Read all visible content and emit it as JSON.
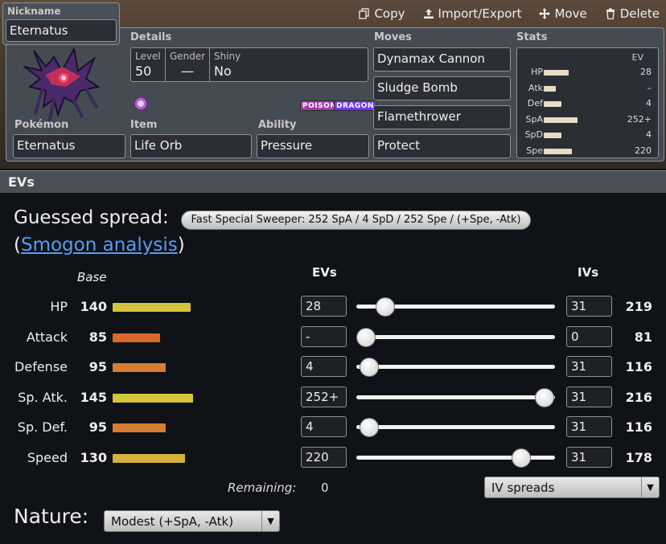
{
  "toolbar": {
    "copy": "Copy",
    "import_export": "Import/Export",
    "move": "Move",
    "delete": "Delete"
  },
  "nickname": {
    "label": "Nickname",
    "value": "Eternatus"
  },
  "details": {
    "label": "Details",
    "level_label": "Level",
    "level": "50",
    "gender_label": "Gender",
    "gender": "—",
    "shiny_label": "Shiny",
    "shiny": "No"
  },
  "pokemon": {
    "label": "Pokémon",
    "value": "Eternatus"
  },
  "item": {
    "label": "Item",
    "value": "Life Orb"
  },
  "ability": {
    "label": "Ability",
    "value": "Pressure"
  },
  "types": [
    {
      "name": "POISON",
      "color": "#a040a0"
    },
    {
      "name": "DRAGON",
      "color": "#7038f8"
    }
  ],
  "moves": {
    "label": "Moves",
    "list": [
      "Dynamax Cannon",
      "Sludge Bomb",
      "Flamethrower",
      "Protect"
    ]
  },
  "stats": {
    "label": "Stats",
    "ev_header": "EV",
    "rows": [
      {
        "name": "HP",
        "ev": "28",
        "bar": 0.45
      },
      {
        "name": "Atk",
        "ev": "–",
        "bar": 0.22
      },
      {
        "name": "Def",
        "ev": "4",
        "bar": 0.33
      },
      {
        "name": "SpA",
        "ev": "252+",
        "bar": 0.62
      },
      {
        "name": "SpD",
        "ev": "4",
        "bar": 0.33
      },
      {
        "name": "Spe",
        "ev": "220",
        "bar": 0.52
      }
    ]
  },
  "ev_panel": {
    "title": "EVs",
    "guessed_label": "Guessed spread:",
    "guessed_value": "Fast Special Sweeper: 252 SpA / 4 SpD / 252 Spe / (+Spe, -Atk)",
    "smogon_open": "(",
    "smogon_link": "Smogon analysis",
    "smogon_close": ")",
    "base_header": "Base",
    "evs_header": "EVs",
    "ivs_header": "IVs",
    "remaining_label": "Remaining:",
    "remaining_value": "0",
    "iv_spreads": "IV spreads",
    "nature_label": "Nature:",
    "nature_value": "Modest (+SpA, -Atk)"
  },
  "ev_rows": [
    {
      "name": "HP",
      "base": "140",
      "ev": "28",
      "iv": "31",
      "total": "219",
      "slider": 0.11,
      "color": "#d4c43c"
    },
    {
      "name": "Attack",
      "base": "85",
      "ev": "-",
      "iv": "0",
      "total": "81",
      "slider": 0.0,
      "color": "#d86830"
    },
    {
      "name": "Defense",
      "base": "95",
      "ev": "4",
      "iv": "31",
      "total": "116",
      "slider": 0.016,
      "color": "#d87c30"
    },
    {
      "name": "Sp. Atk.",
      "base": "145",
      "ev": "252+",
      "iv": "31",
      "total": "216",
      "slider": 1.0,
      "color": "#d4c43c"
    },
    {
      "name": "Sp. Def.",
      "base": "95",
      "ev": "4",
      "iv": "31",
      "total": "116",
      "slider": 0.016,
      "color": "#d87c30"
    },
    {
      "name": "Speed",
      "base": "130",
      "ev": "220",
      "iv": "31",
      "total": "178",
      "slider": 0.87,
      "color": "#d4b23c"
    }
  ]
}
